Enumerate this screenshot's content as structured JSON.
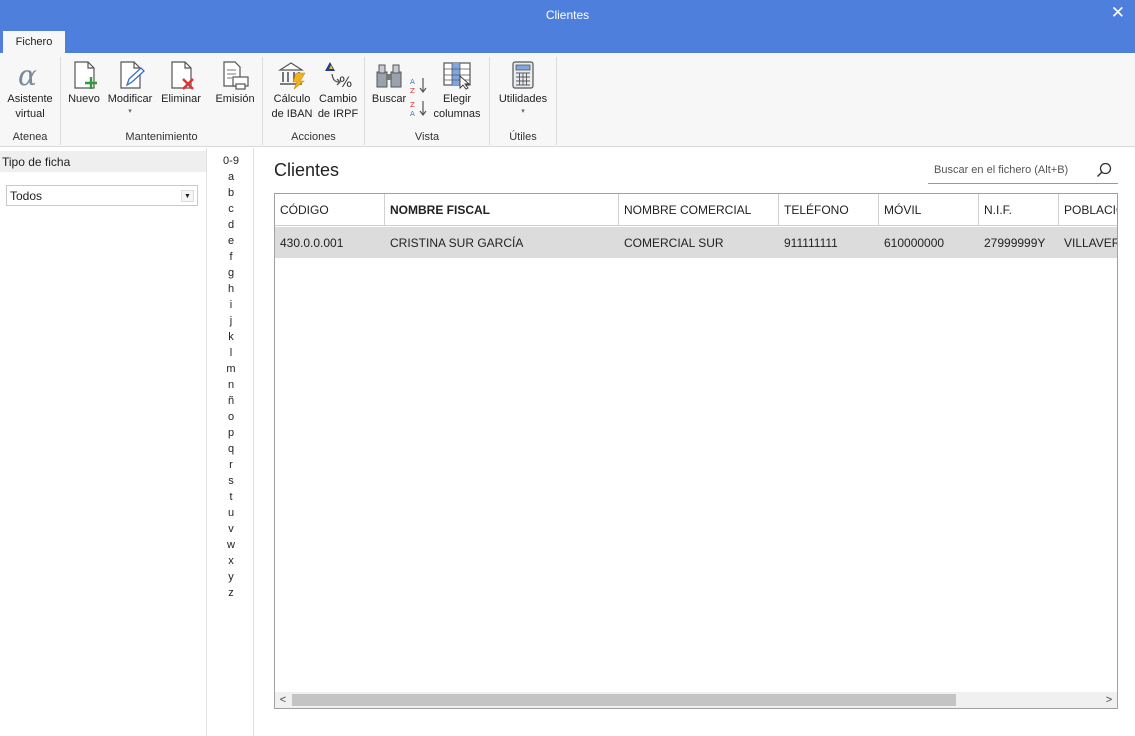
{
  "window": {
    "title": "Clientes",
    "close_glyph": "✕"
  },
  "ribbon": {
    "tab": "Fichero",
    "groups": {
      "atenea": "Atenea",
      "mantenimiento": "Mantenimiento",
      "acciones": "Acciones",
      "vista": "Vista",
      "utiles": "Útiles"
    },
    "buttons": {
      "asistente": "Asistente\nvirtual",
      "nuevo": "Nuevo",
      "modificar": "Modificar",
      "eliminar": "Eliminar",
      "emision": "Emisión",
      "calculo_iban": "Cálculo\nde IBAN",
      "cambio_irpf": "Cambio\nde IRPF",
      "buscar": "Buscar",
      "elegir_columnas": "Elegir\ncolumnas",
      "utilidades": "Utilidades"
    },
    "caret": "▾"
  },
  "left_panel": {
    "header": "Tipo de ficha",
    "select_value": "Todos",
    "select_arrow": "▼"
  },
  "alphabet": [
    "0-9",
    "a",
    "b",
    "c",
    "d",
    "e",
    "f",
    "g",
    "h",
    "i",
    "j",
    "k",
    "l",
    "m",
    "n",
    "ñ",
    "o",
    "p",
    "q",
    "r",
    "s",
    "t",
    "u",
    "v",
    "w",
    "x",
    "y",
    "z"
  ],
  "main": {
    "title": "Clientes",
    "search_placeholder": "Buscar en el fichero (Alt+B)"
  },
  "table": {
    "columns": [
      "CÓDIGO",
      "NOMBRE FISCAL",
      "NOMBRE COMERCIAL",
      "TELÉFONO",
      "MÓVIL",
      "N.I.F.",
      "POBLACIÓN"
    ],
    "rows": [
      [
        "430.0.0.001",
        "CRISTINA SUR GARCÍA",
        "COMERCIAL SUR",
        "911111111",
        "610000000",
        "27999999Y",
        "VILLAVERDE"
      ]
    ],
    "scroll_left": "<",
    "scroll_right": ">"
  },
  "colors": {
    "titlebar": "#4f7fdd",
    "row_selected": "#dcdcdc"
  }
}
